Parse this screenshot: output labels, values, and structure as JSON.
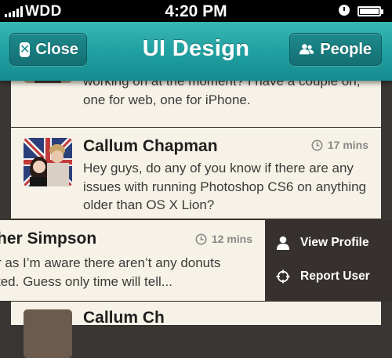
{
  "status_bar": {
    "carrier": "WDD",
    "time": "4:20 PM",
    "icons": [
      "signal-icon",
      "alarm-icon",
      "battery-icon"
    ]
  },
  "nav_bar": {
    "title": "UI Design",
    "close_label": "Close",
    "people_label": "People",
    "accent_color": "#1f9ea0"
  },
  "messages": [
    {
      "text": "working on at the moment? I have a couple on, one for web, one for iPhone."
    },
    {
      "name": "Callum Chapman",
      "time": "17 mins",
      "text": "Hey guys, do any of you know if there are any issues with running Photoshop CS6 on anything older than OS X Lion?"
    },
    {
      "name": "her Simpson",
      "time": "12 mins",
      "text_line1": "r as I’m aware there aren’t any donuts",
      "text_line2": "ted. Guess only time will tell..."
    },
    {
      "name": "Callum Ch"
    }
  ],
  "actions": {
    "view_profile": "View Profile",
    "report_user": "Report User"
  }
}
